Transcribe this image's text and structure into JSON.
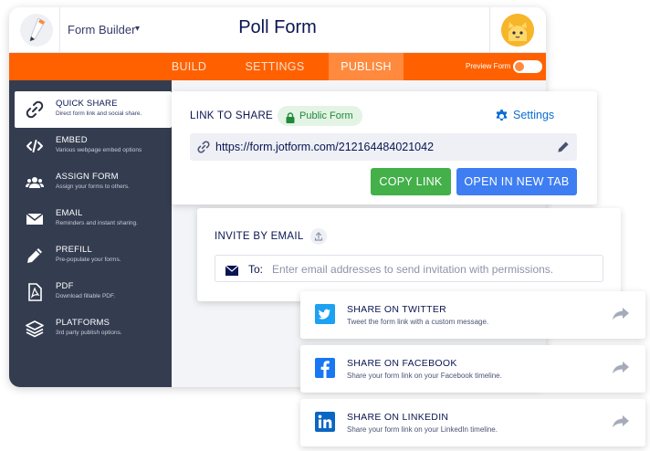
{
  "header": {
    "builder_label": "Form Builder",
    "form_title": "Poll Form"
  },
  "nav": {
    "tabs": [
      {
        "label": "BUILD",
        "active": false
      },
      {
        "label": "SETTINGS",
        "active": false
      },
      {
        "label": "PUBLISH",
        "active": true
      }
    ],
    "preview_label": "Preview Form",
    "preview_enabled": false
  },
  "sidebar": {
    "items": [
      {
        "title": "QUICK SHARE",
        "subtitle": "Direct form link and social share.",
        "icon": "link-icon",
        "active": true
      },
      {
        "title": "EMBED",
        "subtitle": "Various webpage embed options",
        "icon": "code-icon",
        "active": false
      },
      {
        "title": "ASSIGN FORM",
        "subtitle": "Assign your forms to others.",
        "icon": "users-icon",
        "active": false
      },
      {
        "title": "EMAIL",
        "subtitle": "Reminders and instant sharing.",
        "icon": "envelope-icon",
        "active": false
      },
      {
        "title": "PREFILL",
        "subtitle": "Pre-populate your forms.",
        "icon": "pencil-icon",
        "active": false
      },
      {
        "title": "PDF",
        "subtitle": "Download fillable PDF.",
        "icon": "pdf-icon",
        "active": false
      },
      {
        "title": "PLATFORMS",
        "subtitle": "3rd party publish options.",
        "icon": "layers-icon",
        "active": false
      }
    ]
  },
  "link_share": {
    "heading": "LINK TO SHARE",
    "badge": "Public Form",
    "settings_label": "Settings",
    "url": "https://form.jotform.com/212164484021042",
    "copy_button": "COPY LINK",
    "open_button": "OPEN IN NEW TAB"
  },
  "invite": {
    "heading": "INVITE BY EMAIL",
    "to_label": "To:",
    "placeholder": "Enter email addresses to send invitation with permissions."
  },
  "share_options": [
    {
      "title": "SHARE ON TWITTER",
      "subtitle": "Tweet the form link with a custom message.",
      "icon": "twitter-icon",
      "color": "#1da1f2"
    },
    {
      "title": "SHARE ON FACEBOOK",
      "subtitle": "Share your form link on your Facebook timeline.",
      "icon": "facebook-icon",
      "color": "#1877f2"
    },
    {
      "title": "SHARE ON LINKEDIN",
      "subtitle": "Share your form link on your LinkedIn timeline.",
      "icon": "linkedin-icon",
      "color": "#0a66c2"
    }
  ],
  "colors": {
    "accent_orange": "#ff6100",
    "sidebar_bg": "#343c50",
    "copy_green": "#43b049",
    "open_blue": "#3e7ef2"
  }
}
